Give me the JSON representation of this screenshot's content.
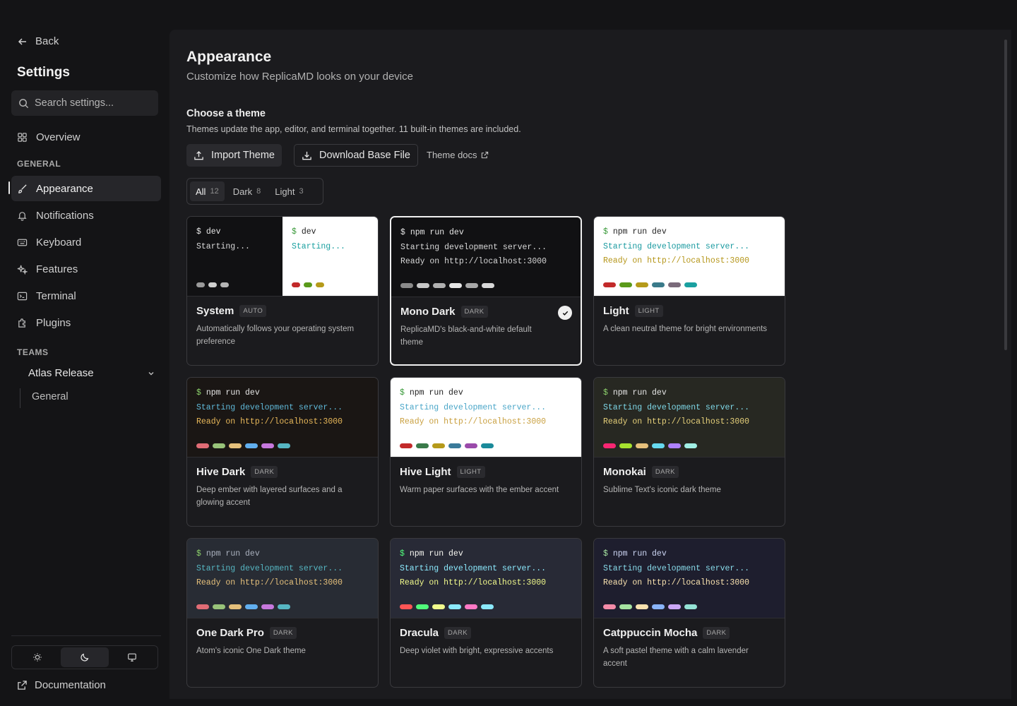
{
  "sidebar": {
    "back_label": "Back",
    "title": "Settings",
    "search_placeholder": "Search settings...",
    "overview_label": "Overview",
    "general_label": "GENERAL",
    "items": [
      {
        "label": "Appearance",
        "icon": "brush-icon"
      },
      {
        "label": "Notifications",
        "icon": "bell-icon"
      },
      {
        "label": "Keyboard",
        "icon": "keyboard-icon"
      },
      {
        "label": "Features",
        "icon": "sparkles-icon"
      },
      {
        "label": "Terminal",
        "icon": "terminal-icon"
      },
      {
        "label": "Plugins",
        "icon": "puzzle-icon"
      }
    ],
    "teams_label": "TEAMS",
    "team_name": "Atlas Release",
    "team_sub": "General",
    "mode_selected": "dark",
    "docs_label": "Documentation"
  },
  "header": {
    "title": "Appearance",
    "subtitle": "Customize how ReplicaMD looks on your device"
  },
  "themes_section": {
    "title": "Choose a theme",
    "description": "Themes update the app, editor, and terminal together. 11 built-in themes are included.",
    "import_label": "Import Theme",
    "download_label": "Download Base File",
    "docs_link": "Theme docs"
  },
  "filters": [
    {
      "label": "All",
      "count": "12"
    },
    {
      "label": "Dark",
      "count": "8"
    },
    {
      "label": "Light",
      "count": "3"
    }
  ],
  "terminal": {
    "system_cmd": "dev",
    "system_line": "Starting...",
    "cmd": "npm run dev",
    "line1": "Starting development server...",
    "line2": "Ready on http://localhost:3000"
  },
  "themes": [
    {
      "name": "System",
      "badge": "AUTO",
      "desc": "Automatically follows your operating system preference"
    },
    {
      "name": "Mono Dark",
      "badge": "DARK",
      "desc": "ReplicaMD's black-and-white default theme",
      "selected": true
    },
    {
      "name": "Light",
      "badge": "LIGHT",
      "desc": "A clean neutral theme for bright environments"
    },
    {
      "name": "Hive Dark",
      "badge": "DARK",
      "desc": "Deep ember with layered surfaces and a glowing accent"
    },
    {
      "name": "Hive Light",
      "badge": "LIGHT",
      "desc": "Warm paper surfaces with the ember accent"
    },
    {
      "name": "Monokai",
      "badge": "DARK",
      "desc": "Sublime Text's iconic dark theme"
    },
    {
      "name": "One Dark Pro",
      "badge": "DARK",
      "desc": "Atom's iconic One Dark theme"
    },
    {
      "name": "Dracula",
      "badge": "DARK",
      "desc": "Deep violet with bright, expressive accents"
    },
    {
      "name": "Catppuccin Mocha",
      "badge": "DARK",
      "desc": "A soft pastel theme with a calm lavender accent"
    }
  ],
  "colors": {
    "mono_swatches": [
      "#8a8a8a",
      "#c8c8c8",
      "#b0b0b0",
      "#e6e6e6",
      "#a8a8a8",
      "#d8d8d8"
    ],
    "light_swatches": [
      "#c22a2a",
      "#5a9a1a",
      "#b59a1a",
      "#3a7a8a",
      "#7a6a7a",
      "#1aa0a0"
    ],
    "hive_dark_swatches": [
      "#e06c75",
      "#98c379",
      "#e5c07b",
      "#61afef",
      "#c678dd",
      "#56b6c2"
    ],
    "hive_light_swatches": [
      "#c22a2a",
      "#3a7a4a",
      "#b59a1a",
      "#3a7a9a",
      "#9a4aaa",
      "#1a8a9a"
    ],
    "monokai_swatches": [
      "#f92672",
      "#a6e22e",
      "#e6c07b",
      "#66d9ef",
      "#ae81ff",
      "#a1efe4"
    ],
    "onedark_swatches": [
      "#e06c75",
      "#98c379",
      "#e5c07b",
      "#61afef",
      "#c678dd",
      "#56b6c2"
    ],
    "dracula_swatches": [
      "#ff5555",
      "#50fa7b",
      "#f1fa8c",
      "#8be9fd",
      "#ff79c6",
      "#8be9fd"
    ],
    "catppuccin_swatches": [
      "#f38ba8",
      "#a6e3a1",
      "#f9e2af",
      "#89b4fa",
      "#cba6f7",
      "#94e2d5"
    ]
  }
}
